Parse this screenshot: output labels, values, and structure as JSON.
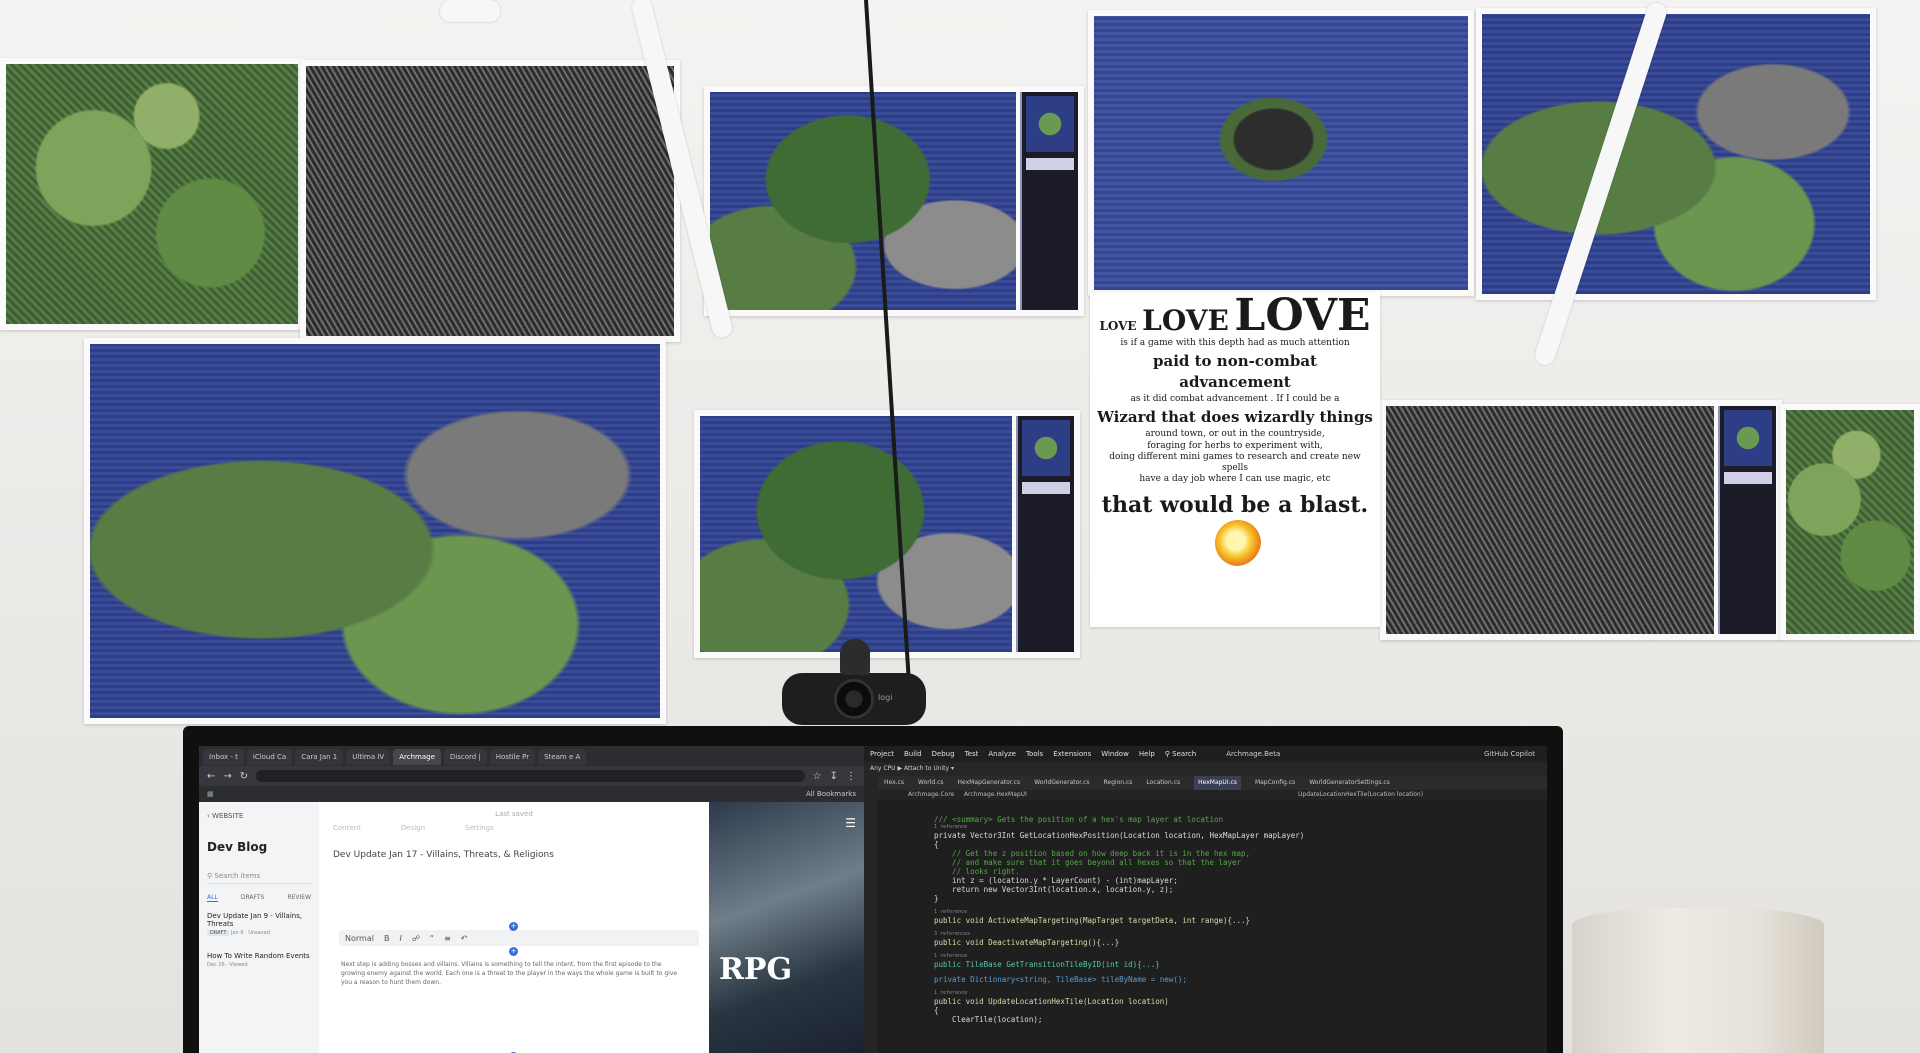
{
  "poster": {
    "love_small": "LOVE",
    "love_medium": "LOVE",
    "love_large": "LOVE",
    "line1": "is if a game with this depth had as much attention",
    "line2": "paid to non-combat advancement",
    "line3": "as it did combat advancement . If I could be a",
    "line4": "Wizard that does wizardly things",
    "line5": "around town, or out in the countryside,",
    "line6": "foraging for herbs to experiment with,",
    "line7": "doing different mini games to research and create new spells",
    "line8": "have a day job where I can use magic, etc",
    "line9": "that would be a blast."
  },
  "webcam": {
    "brand": "logi"
  },
  "browser": {
    "tabs": [
      "Inbox - t",
      "iCloud Ca",
      "Cara Jan 1",
      "Ultima IV",
      "Archmage",
      "Discord |",
      "Hostile Pr",
      "Steam e A"
    ],
    "active_tab_index": 4,
    "bookmarks_label": "All Bookmarks",
    "blog": {
      "back_label": "WEBSITE",
      "title": "Dev Blog",
      "search_placeholder": "Search items",
      "filters": [
        "ALL",
        "DRAFTS",
        "REVIEW"
      ],
      "posts": [
        {
          "title": "Dev Update Jan 9 - Villains, Threats",
          "badge": "DRAFT",
          "meta": "Jan 9 · Unsaved"
        },
        {
          "title": "How To Write Random Events",
          "meta": "Dec 26 · Viewed"
        }
      ]
    },
    "editor": {
      "status": "Last saved",
      "tabs": [
        "Content",
        "Design",
        "Settings"
      ],
      "post_title": "Dev Update Jan 17 - Villains, Threats, & Religions",
      "toolbar_style": "Normal",
      "body": "Next step is adding bosses and villains. Villains is something to tell the intent, from the first episode to the growing enemy against the world. Each one is a threat to the player in the ways the whole game is built to give you a reason to hunt them down."
    },
    "preview": {
      "heading": "RPG"
    }
  },
  "ide": {
    "menu": [
      "Project",
      "Build",
      "Debug",
      "Test",
      "Analyze",
      "Tools",
      "Extensions",
      "Window",
      "Help"
    ],
    "search_label": "Search",
    "solution_title": "Archmage.Beta",
    "copilot_label": "GitHub Copilot",
    "toolbar_text": "Any CPU     ▶ Attach to Unity ▾",
    "tabs": [
      "Hex.cs",
      "World.cs",
      "HexMapGenerator.cs",
      "WorldGenerator.cs",
      "Region.cs",
      "Location.cs",
      "HexMapUI.cs",
      "MapConfig.cs",
      "WorldGeneratorSettings.cs"
    ],
    "active_tab_index": 6,
    "nav_left": "Archmage.Core",
    "nav_mid": "Archmage.HexMapUI",
    "nav_right": "UpdateLocationHexTile(Location location)",
    "code": {
      "l1": "/// <summary> Gets the position of a hex's map layer at location",
      "ref1": "1 reference",
      "l2": "private Vector3Int GetLocationHexPosition(Location location, HexMapLayer mapLayer)",
      "l3": "{",
      "l4": "    // Get the z position based on how deep back it is in the hex map,",
      "l5": "    // and make sure that it goes beyond all hexes so that the layer",
      "l6": "    // looks right.",
      "l7": "    int z = (location.y * LayerCount) - (int)mapLayer;",
      "l8": "",
      "l9": "    return new Vector3Int(location.x, location.y, z);",
      "l10": "}",
      "ref2": "1 reference",
      "l11": "public void ActivateMapTargeting(MapTarget targetData, int range){...}",
      "ref3": "3 references",
      "l12": "public void DeactivateMapTargeting(){...}",
      "ref4": "1 reference",
      "l13": "public TileBase GetTransitionTileByID(int id){...}",
      "l14": "private Dictionary<string, TileBase> tileByName = new();",
      "ref5": "1 reference",
      "l15": "public void UpdateLocationHexTile(Location location)",
      "l16": "{",
      "l17": "    ClearTile(location);"
    }
  }
}
